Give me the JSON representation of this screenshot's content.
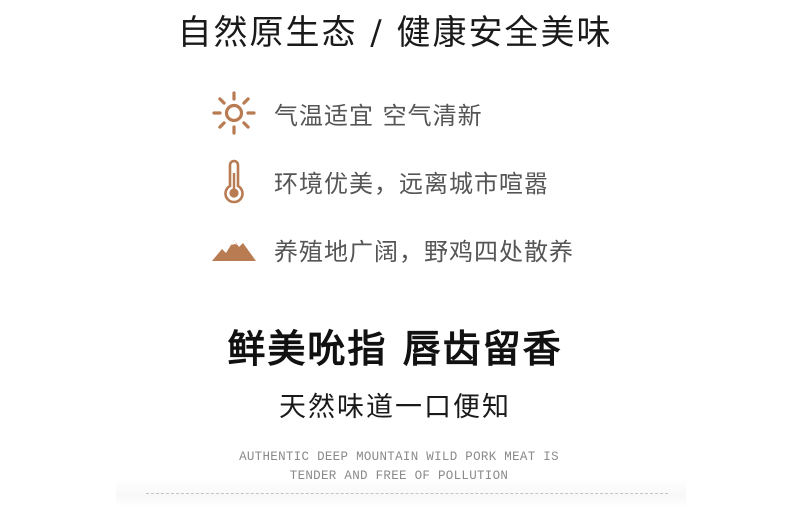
{
  "headline": "自然原生态 / 健康安全美味",
  "features": [
    {
      "icon": "sun-icon",
      "label": "气温适宜 空气清新"
    },
    {
      "icon": "thermometer-icon",
      "label": "环境优美，远离城市喧嚣"
    },
    {
      "icon": "mountains-icon",
      "label": "养殖地广阔，野鸡四处散养"
    }
  ],
  "slogan": "鲜美吮指 唇齿留香",
  "subslogan": "天然味道一口便知",
  "english": {
    "line1": "AUTHENTIC DEEP MOUNTAIN WILD PORK MEAT IS",
    "line2": "TENDER AND FREE OF POLLUTION"
  },
  "colors": {
    "icon": "#b87b52",
    "text_gray": "#555555",
    "text_dark": "#111111"
  }
}
